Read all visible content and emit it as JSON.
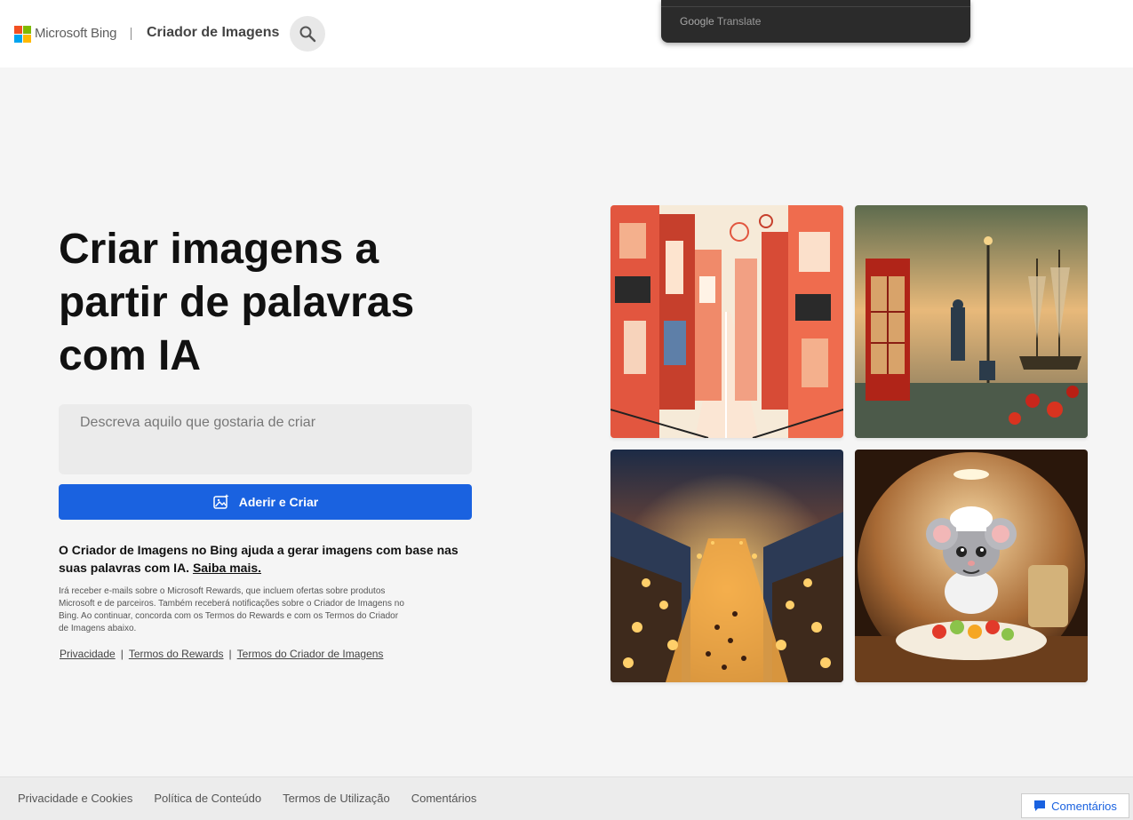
{
  "header": {
    "brand": "Microsoft Bing",
    "app_title": "Criador de Imagens",
    "search_icon": "search-icon"
  },
  "translate_popup": {
    "google": "Google",
    "label": "Translate"
  },
  "hero": {
    "title": "Criar imagens a partir de palavras com IA",
    "prompt_placeholder": "Descreva aquilo que gostaria de criar",
    "prompt_value": "",
    "create_button": "Aderir e Criar",
    "create_icon": "image-sparkle-icon",
    "description": "O Criador de Imagens no Bing ajuda a gerar imagens com base nas suas palavras com IA.",
    "learn_more": "Saiba mais.",
    "fine_print": "Irá receber e-mails sobre o Microsoft Rewards, que incluem ofertas sobre produtos Microsoft e de parceiros. Também receberá notificações sobre o Criador de Imagens no Bing. Ao continuar, concorda com os Termos do Rewards e com os Termos do Criador de Imagens abaixo.",
    "links": [
      "Privacidade",
      "Termos do Rewards",
      "Termos do Criador de Imagens"
    ],
    "link_separator": "|"
  },
  "gallery": [
    {
      "subject": "abstract-city-street"
    },
    {
      "subject": "red-phone-booth-harbor-painting"
    },
    {
      "subject": "lantern-festival-night-town"
    },
    {
      "subject": "chef-mouse-kitchen"
    }
  ],
  "footer": {
    "links": [
      "Privacidade e Cookies",
      "Política de Conteúdo",
      "Termos de Utilização",
      "Comentários"
    ],
    "feedback_button": "Comentários",
    "feedback_icon": "chat-bubble-icon"
  },
  "colors": {
    "accent": "#1a62e0",
    "page_bg": "#f5f5f5"
  }
}
